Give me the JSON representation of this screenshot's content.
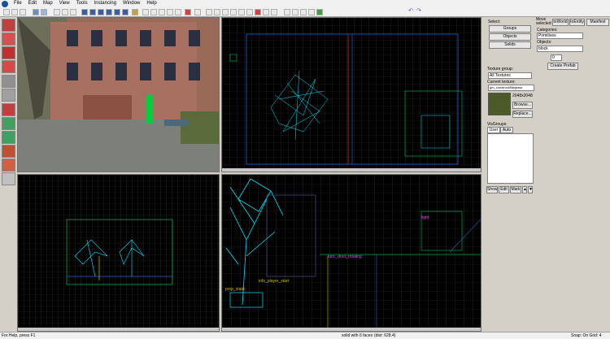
{
  "menu": [
    "File",
    "Edit",
    "Map",
    "View",
    "Tools",
    "Instancing",
    "Window",
    "Help"
  ],
  "views": {
    "top_right_labels": [],
    "bottom_right_labels": {
      "door": "func_door_rotating",
      "player": "info_player_start",
      "prop": "prop_static",
      "light": "light"
    }
  },
  "select_panel": {
    "title": "Select:",
    "groups": "Groups",
    "objects": "Objects",
    "solids": "Solids",
    "texture_group_label": "Texture group:",
    "texture_group_value": "All Textures",
    "current_texture_label": "Current texture:",
    "current_texture_value": "gm_construct/flatgrass",
    "texture_size": "2048x2048",
    "browse": "Browse...",
    "replace": "Replace...",
    "visgroups": "VisGroups:",
    "tab_user": "User",
    "tab_auto": "Auto",
    "show": "Show",
    "edit": "Edit",
    "mark": "Mark"
  },
  "right_panel": {
    "move_selected": "Move selected",
    "to_world": "toWorld",
    "to_entity": "toEntity",
    "manifest": "Manifest",
    "categories_label": "Categories:",
    "categories_value": "Primitives",
    "objects_label": "Objects:",
    "objects_value": "block",
    "faces_value": "0",
    "create_prefab": "Create Prefab"
  },
  "status": {
    "help": "For Help, press F1",
    "selection": "solid with 6 faces",
    "dist": "(dist: 628.4)",
    "snap": "Snap: On Grid: 4"
  },
  "colors": {
    "grid": "#2a2a2a",
    "wire": "#00e5ff",
    "accent_green": "#00a651",
    "brand": "#1a4fa0"
  }
}
